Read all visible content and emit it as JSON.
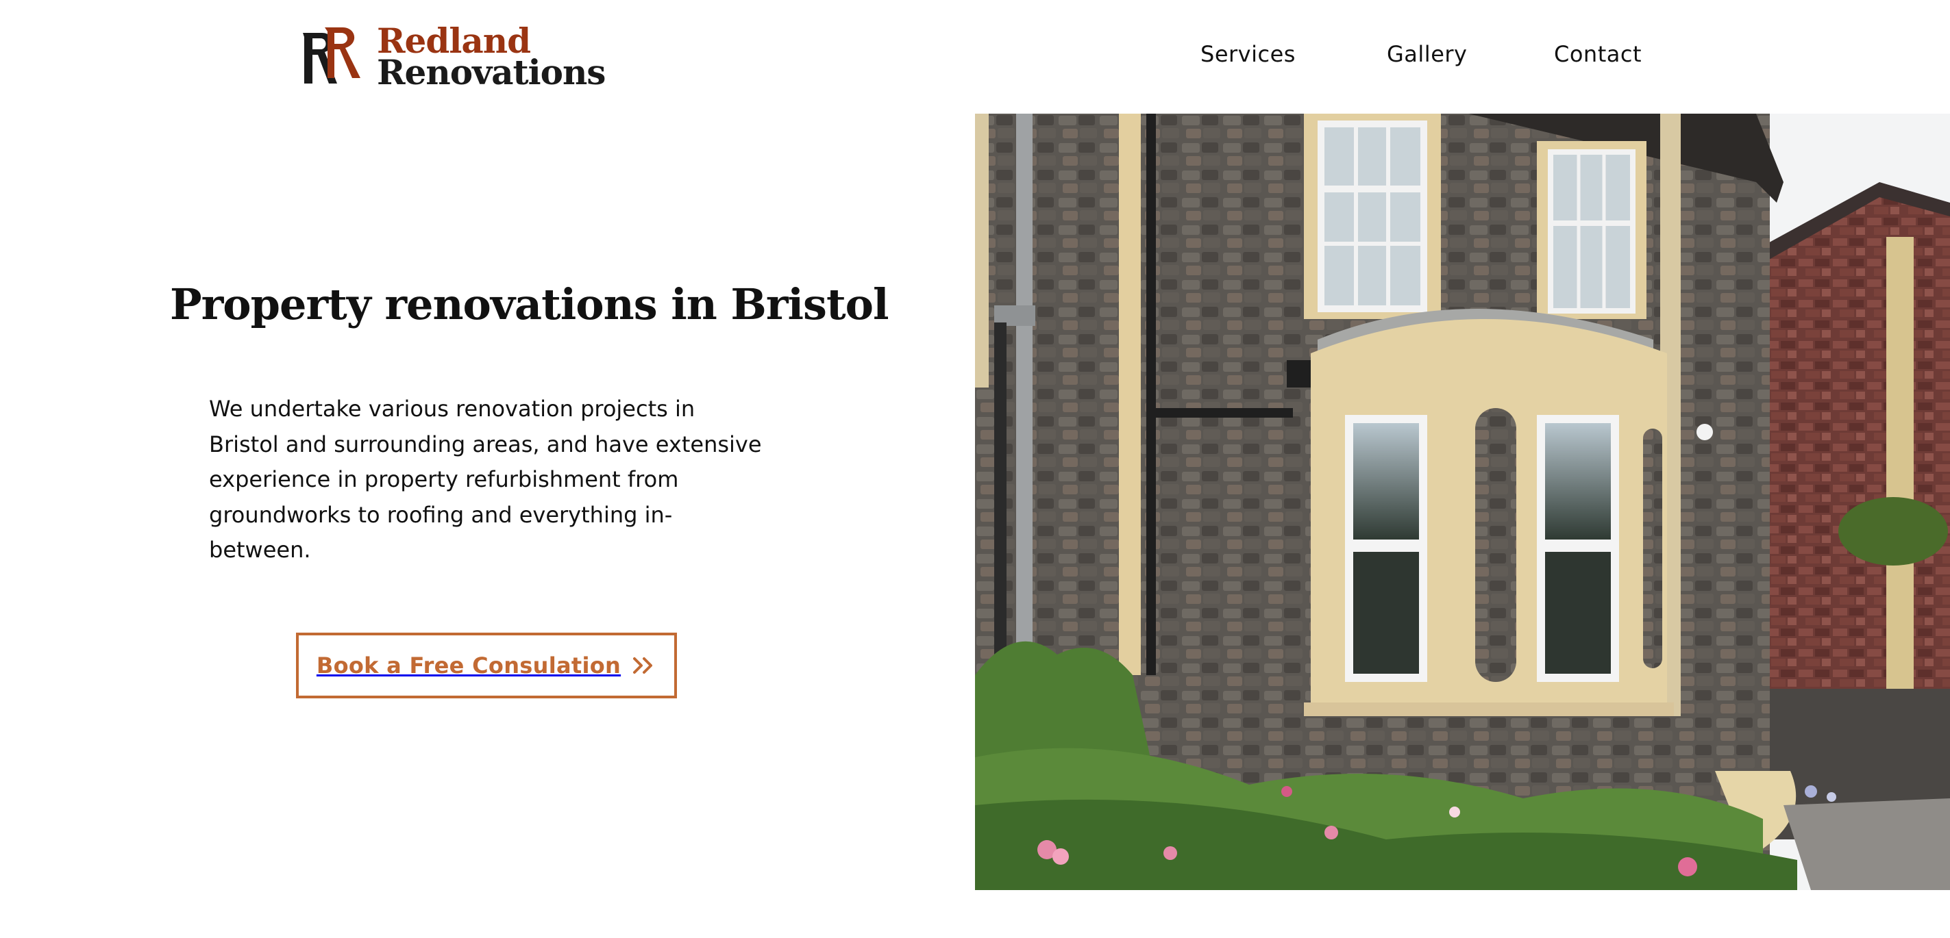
{
  "brand": {
    "name_line1": "Redland",
    "name_line2": "Renovations",
    "colors": {
      "accent": "#9a3412",
      "dark": "#1a1a1a"
    }
  },
  "nav": {
    "items": [
      {
        "label": "Services"
      },
      {
        "label": "Gallery"
      },
      {
        "label": "Contact"
      }
    ]
  },
  "hero": {
    "title": "Property renovations in Bristol",
    "text": "We undertake various renovation projects in Bristol and surrounding areas, and have extensive experience in property refurbishment from groundworks to roofing and everything in-between.",
    "cta": {
      "label": "Book a Free Consulation",
      "icon": "double-chevron-right-icon",
      "color": "#c26a33"
    },
    "photo": {
      "subject": "stone-house-with-bay-window-icon"
    }
  }
}
